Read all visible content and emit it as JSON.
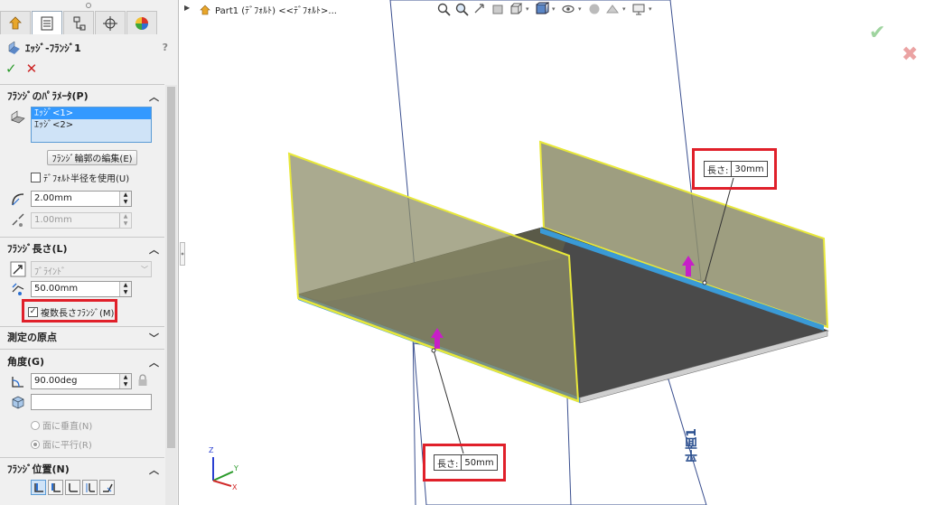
{
  "property_manager": {
    "tabs": [
      {
        "name": "feature-manager-tab",
        "icon": "feature-manager-icon"
      },
      {
        "name": "property-manager-tab",
        "icon": "property-manager-icon"
      },
      {
        "name": "configuration-manager-tab",
        "icon": "configuration-manager-icon"
      },
      {
        "name": "dimxpert-manager-tab",
        "icon": "dimxpert-manager-icon"
      },
      {
        "name": "display-manager-tab",
        "icon": "display-manager-icon"
      }
    ],
    "title": "ｴｯｼﾞ-ﾌﾗﾝｼﾞ1",
    "help": "?",
    "ok_label": "✓",
    "cancel_label": "✕",
    "sections": {
      "params": {
        "header": "ﾌﾗﾝｼﾞのﾊﾟﾗﾒｰﾀ(P)",
        "edges": [
          "ｴｯｼﾞ<1>",
          "ｴｯｼﾞ<2>"
        ],
        "edit_profile_button": "ﾌﾗﾝｼﾞ輪郭の編集(E)",
        "use_default_radius": "ﾃﾞﾌｫﾙﾄ半径を使用(U)",
        "bend_radius": "2.00mm",
        "gap": "1.00mm"
      },
      "length": {
        "header": "ﾌﾗﾝｼﾞ長さ(L)",
        "end_condition": "ﾌﾞﾗｲﾝﾄﾞ",
        "length_value": "50.00mm",
        "multi_length_checkbox": "複数長さﾌﾗﾝｼﾞ(M)",
        "multi_length_checked": true
      },
      "origin": {
        "header": "測定の原点"
      },
      "angle": {
        "header": "角度(G)",
        "angle_value": "90.00deg",
        "perpendicular": "面に垂直(N)",
        "parallel": "面に平行(R)"
      },
      "position": {
        "header": "ﾌﾗﾝｼﾞ位置(N)"
      }
    },
    "highlight_color": "#e0202a"
  },
  "viewport": {
    "tree_label": "Part1 (ﾃﾞﾌｫﾙﾄ) <<ﾃﾞﾌｫﾙﾄ>...",
    "heads_up_icons": [
      "zoom-to-fit-icon",
      "zoom-area-icon",
      "previous-view-icon",
      "section-view-icon",
      "view-orientation-icon",
      "display-style-icon",
      "hide-show-icon",
      "edit-appearance-icon",
      "apply-scene-icon",
      "view-settings-icon"
    ],
    "callout_top": {
      "label": "長さ:",
      "value": "30mm"
    },
    "callout_bottom": {
      "label": "長さ:",
      "value": "50mm"
    },
    "plane_label": "平面1",
    "triad": {
      "x": "X",
      "y": "Y",
      "z": "Z"
    },
    "colors": {
      "flange_edge": "#e8e83a",
      "base_plate": "#4a4a4a",
      "flange_face": "#8d8d6a",
      "arrow": "#c71fc7",
      "plane_line": "#3a4f8f"
    }
  }
}
